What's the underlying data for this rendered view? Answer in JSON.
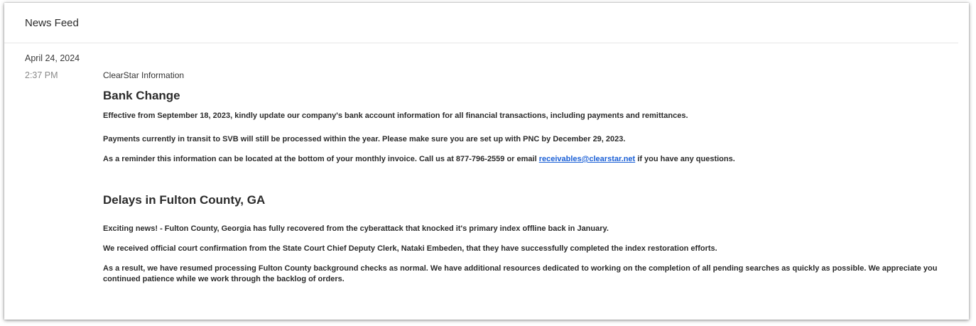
{
  "header": {
    "title": "News Feed"
  },
  "feed": {
    "date": "April 24, 2024",
    "entry": {
      "time": "2:37 PM",
      "source": "ClearStar Information",
      "bank_change": {
        "title": "Bank Change",
        "p1": "Effective from September 18, 2023, kindly update our company's bank account information for all financial transactions, including payments and remittances.",
        "p2": "Payments currently in transit to SVB will still be processed within the year. Please make sure you are set up with PNC by December 29, 2023.",
        "p3_before": "As a reminder this information can be located at the bottom of your monthly invoice. Call us at 877-796-2559 or email ",
        "p3_link": "receivables@clearstar.net",
        "p3_after": " if you have any questions."
      },
      "fulton": {
        "title": "Delays in Fulton County, GA",
        "p1": "Exciting news! - Fulton County, Georgia has fully recovered from the cyberattack that knocked it's primary index offline back in January.",
        "p2": "We received official court confirmation from the State Court Chief Deputy Clerk, Nataki Embeden, that they have successfully completed the index restoration efforts.",
        "p3": "As a result, we have resumed processing Fulton County background checks as normal. We have additional resources dedicated to working on the completion of all pending searches as quickly as possible. We appreciate you continued patience while we work through the backlog of orders."
      }
    }
  }
}
